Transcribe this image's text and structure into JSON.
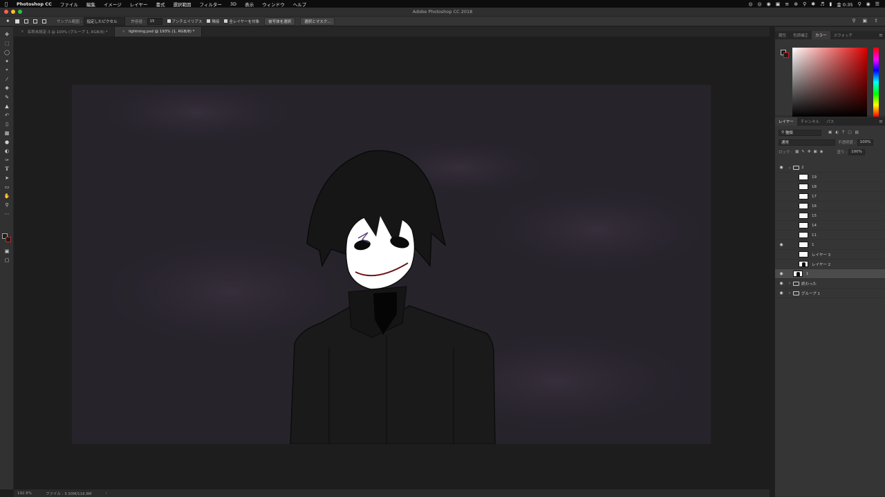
{
  "menubar": {
    "app": "Photoshop CC",
    "items": [
      "ファイル",
      "編集",
      "イメージ",
      "レイヤー",
      "書式",
      "選択範囲",
      "フィルター",
      "3D",
      "表示",
      "ウィンドウ",
      "ヘルプ"
    ],
    "clock": "金 0:35"
  },
  "window": {
    "title": "Adobe Photoshop CC 2018"
  },
  "options": {
    "sample_size_label": "サンプル範囲 :",
    "sample_size_value": "指定したピクセル",
    "tolerance_label": "許容値 :",
    "tolerance_value": "15",
    "antialias_label": "アンチエイリアス",
    "contiguous_label": "隣接",
    "sample_all_label": "全レイヤーを対象",
    "select_subject_label": "被写体を選択",
    "select_mask_label": "選択とマスク..."
  },
  "tabs": [
    {
      "label": "名称未設定-3 @ 100% (グループ 1, RGB/8) *",
      "active": false
    },
    {
      "label": "lightning.psd @ 193% (1, RGB/8) *",
      "active": true
    }
  ],
  "status": {
    "zoom": "192.8%",
    "file": "ファイル : 5.93M/116.8M"
  },
  "color_panel": {
    "tabs": [
      "属性",
      "色調補正",
      "カラー",
      "スウォッチ"
    ],
    "active": "カラー"
  },
  "layers_panel": {
    "tabs": [
      "レイヤー",
      "チャンネル",
      "パス"
    ],
    "active": "レイヤー",
    "filter_value": "種類",
    "blend_mode": "通常",
    "opacity_label": "不透明度 :",
    "opacity_value": "100%",
    "lock_label": "ロック :",
    "fill_label": "塗り :",
    "fill_value": "100%",
    "layers": [
      {
        "name": "2",
        "kind": "group-open",
        "indent": 0,
        "visible": true,
        "selected": false
      },
      {
        "name": "19",
        "kind": "layer",
        "indent": 1,
        "visible": false,
        "selected": false
      },
      {
        "name": "18",
        "kind": "layer",
        "indent": 1,
        "visible": false,
        "selected": false
      },
      {
        "name": "17",
        "kind": "layer",
        "indent": 1,
        "visible": false,
        "selected": false
      },
      {
        "name": "16",
        "kind": "layer",
        "indent": 1,
        "visible": false,
        "selected": false
      },
      {
        "name": "15",
        "kind": "layer",
        "indent": 1,
        "visible": false,
        "selected": false
      },
      {
        "name": "14",
        "kind": "layer",
        "indent": 1,
        "visible": false,
        "selected": false
      },
      {
        "name": "11",
        "kind": "layer",
        "indent": 1,
        "visible": false,
        "selected": false
      },
      {
        "name": "1",
        "kind": "layer",
        "indent": 1,
        "visible": true,
        "selected": false
      },
      {
        "name": "レイヤー 3",
        "kind": "layer",
        "indent": 1,
        "visible": false,
        "selected": false
      },
      {
        "name": "レイヤー 2",
        "kind": "figure",
        "indent": 1,
        "visible": false,
        "selected": false
      },
      {
        "name": "1",
        "kind": "figure",
        "indent": 0,
        "visible": true,
        "selected": true
      },
      {
        "name": "終わった",
        "kind": "group",
        "indent": 0,
        "visible": true,
        "selected": false
      },
      {
        "name": "グループ 1",
        "kind": "group",
        "indent": 0,
        "visible": true,
        "selected": false
      }
    ]
  },
  "toolbar": {
    "tools": [
      "move-tool",
      "marquee-tool",
      "lasso-tool",
      "magic-wand-tool",
      "crop-tool",
      "eyedropper-tool",
      "healing-brush-tool",
      "brush-tool",
      "clone-stamp-tool",
      "history-brush-tool",
      "eraser-tool",
      "gradient-tool",
      "blur-tool",
      "dodge-tool",
      "pen-tool",
      "type-tool",
      "path-selection-tool",
      "rectangle-tool",
      "hand-tool",
      "zoom-tool",
      "more-tools"
    ]
  }
}
